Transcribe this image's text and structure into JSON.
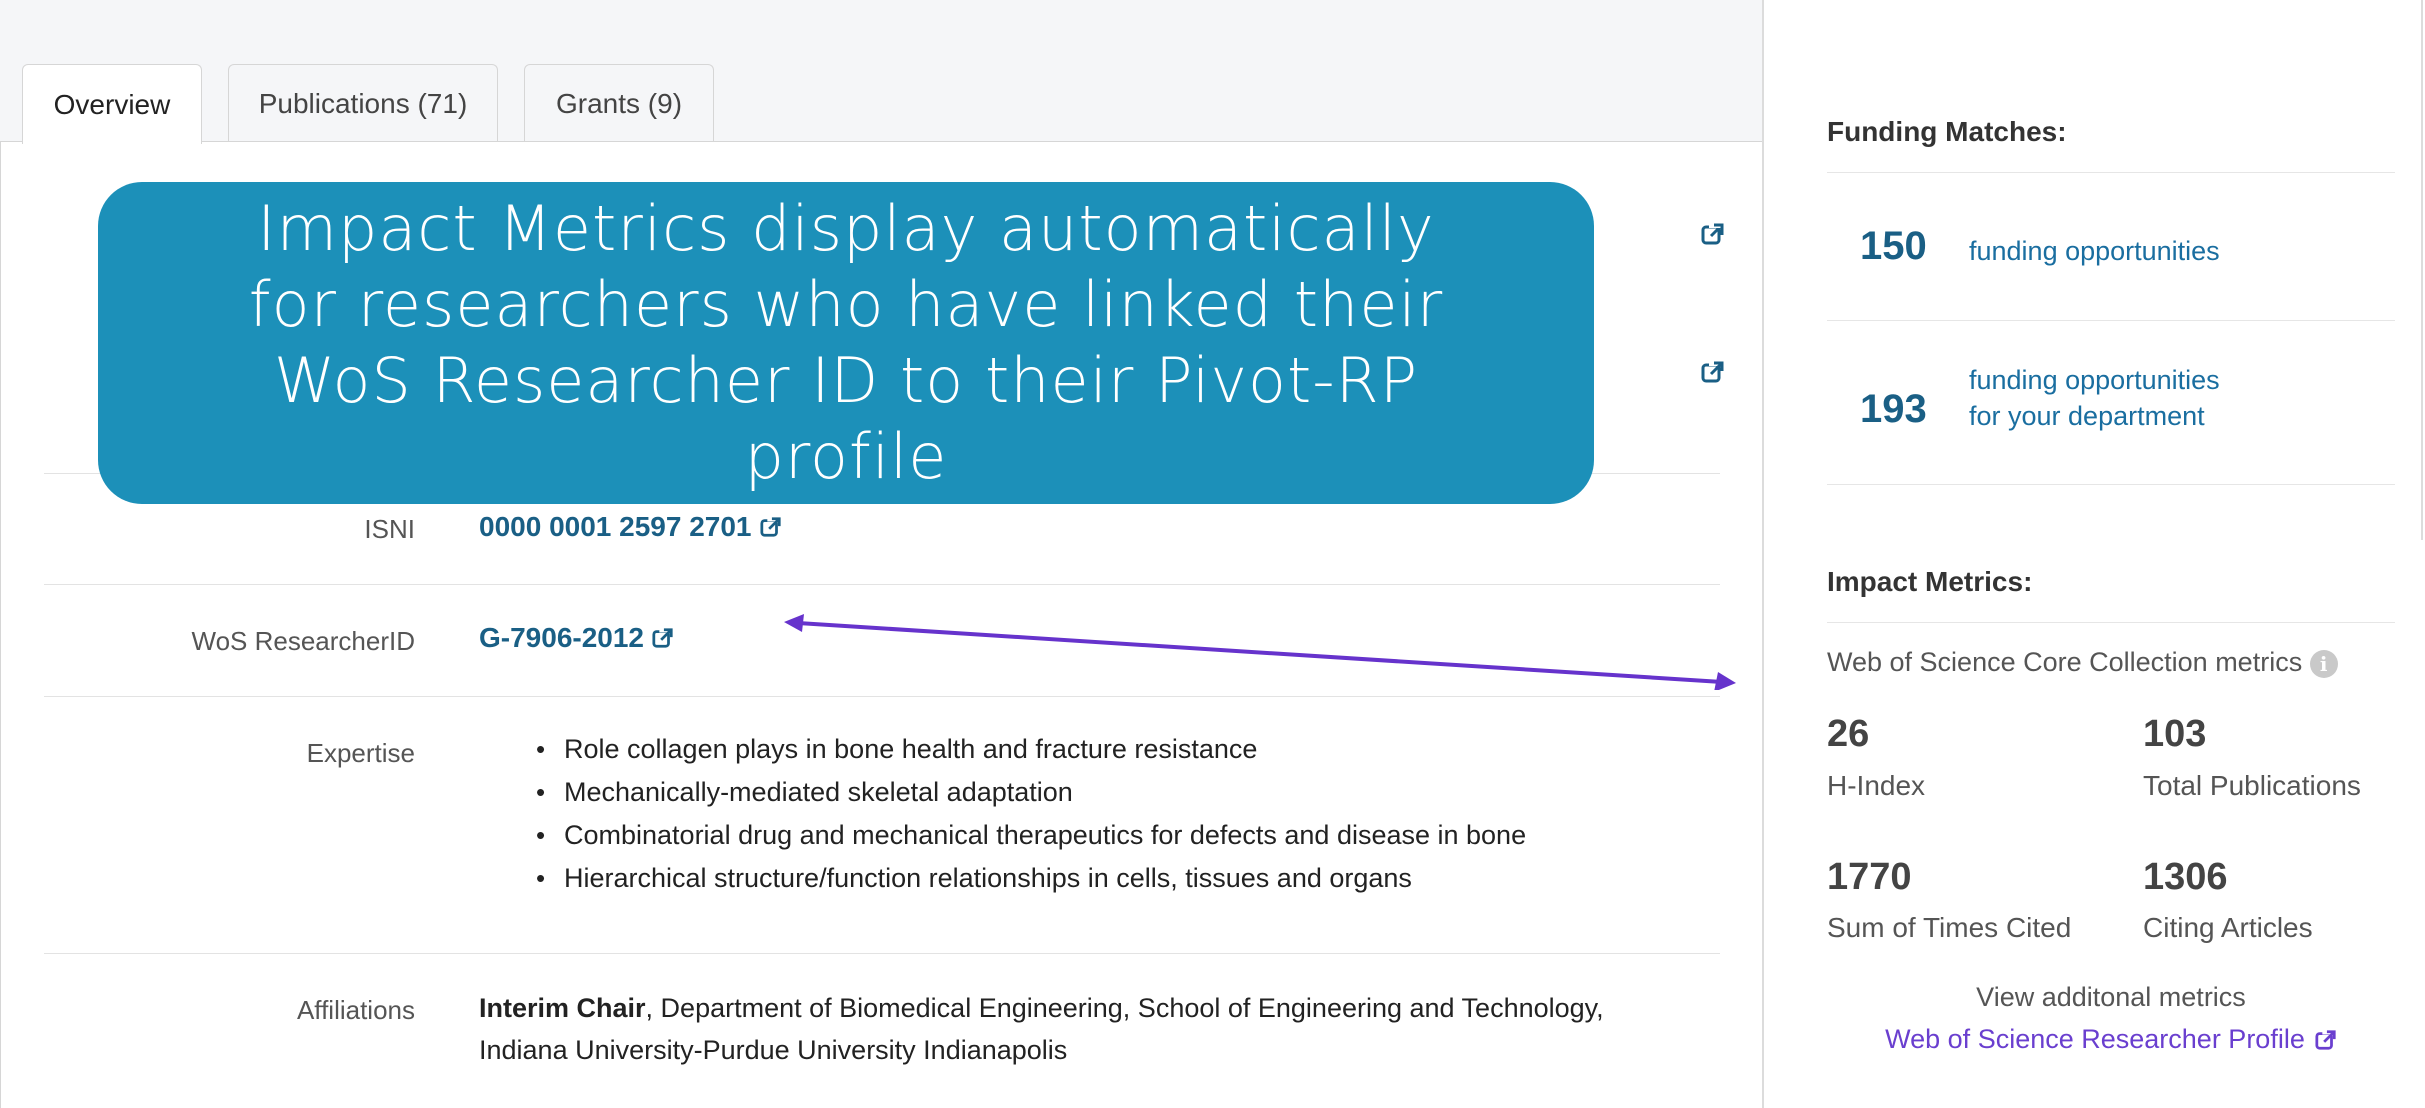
{
  "tabs": [
    {
      "label": "Overview",
      "active": true
    },
    {
      "label": "Publications (71)",
      "active": false
    },
    {
      "label": "Grants (9)",
      "active": false
    }
  ],
  "callout": {
    "text": "Impact Metrics display automatically for researchers who have linked their WoS Researcher ID to their Pivot-RP profile",
    "color": "#1c90b9"
  },
  "profile": {
    "isni": {
      "label": "ISNI",
      "value": "0000 0001 2597 2701"
    },
    "wos": {
      "label": "WoS ResearcherID",
      "value": "G-7906-2012"
    },
    "expertise": {
      "label": "Expertise",
      "items": [
        "Role collagen plays in bone health and fracture resistance",
        "Mechanically-mediated skeletal adaptation",
        "Combinatorial drug and mechanical therapeutics for defects and disease in bone",
        "Hierarchical structure/function relationships in cells, tissues and organs"
      ]
    },
    "affiliations": {
      "label": "Affiliations",
      "title": "Interim Chair",
      "line1": ", Department of Biomedical Engineering, School of Engineering and Technology,",
      "line2": "Indiana University-Purdue University Indianapolis"
    }
  },
  "sidebar": {
    "funding": {
      "heading": "Funding Matches:",
      "items": [
        {
          "count": "150",
          "line1": "funding opportunities",
          "line2": ""
        },
        {
          "count": "193",
          "line1": "funding opportunities",
          "line2": "for your department"
        }
      ]
    },
    "impact": {
      "heading": "Impact Metrics:",
      "subheading": "Web of Science Core Collection metrics",
      "info_icon": "info-icon",
      "metrics": [
        {
          "value": "26",
          "label": "H-Index"
        },
        {
          "value": "103",
          "label": "Total Publications"
        },
        {
          "value": "1770",
          "label": "Sum of Times Cited"
        },
        {
          "value": "1306",
          "label": "Citing Articles"
        }
      ],
      "view_more": "View additonal metrics",
      "profile_link": "Web of Science Researcher Profile"
    }
  },
  "colors": {
    "link": "#1a5f85",
    "arrow": "#6633cc",
    "profile_link": "#6a3fcf"
  }
}
